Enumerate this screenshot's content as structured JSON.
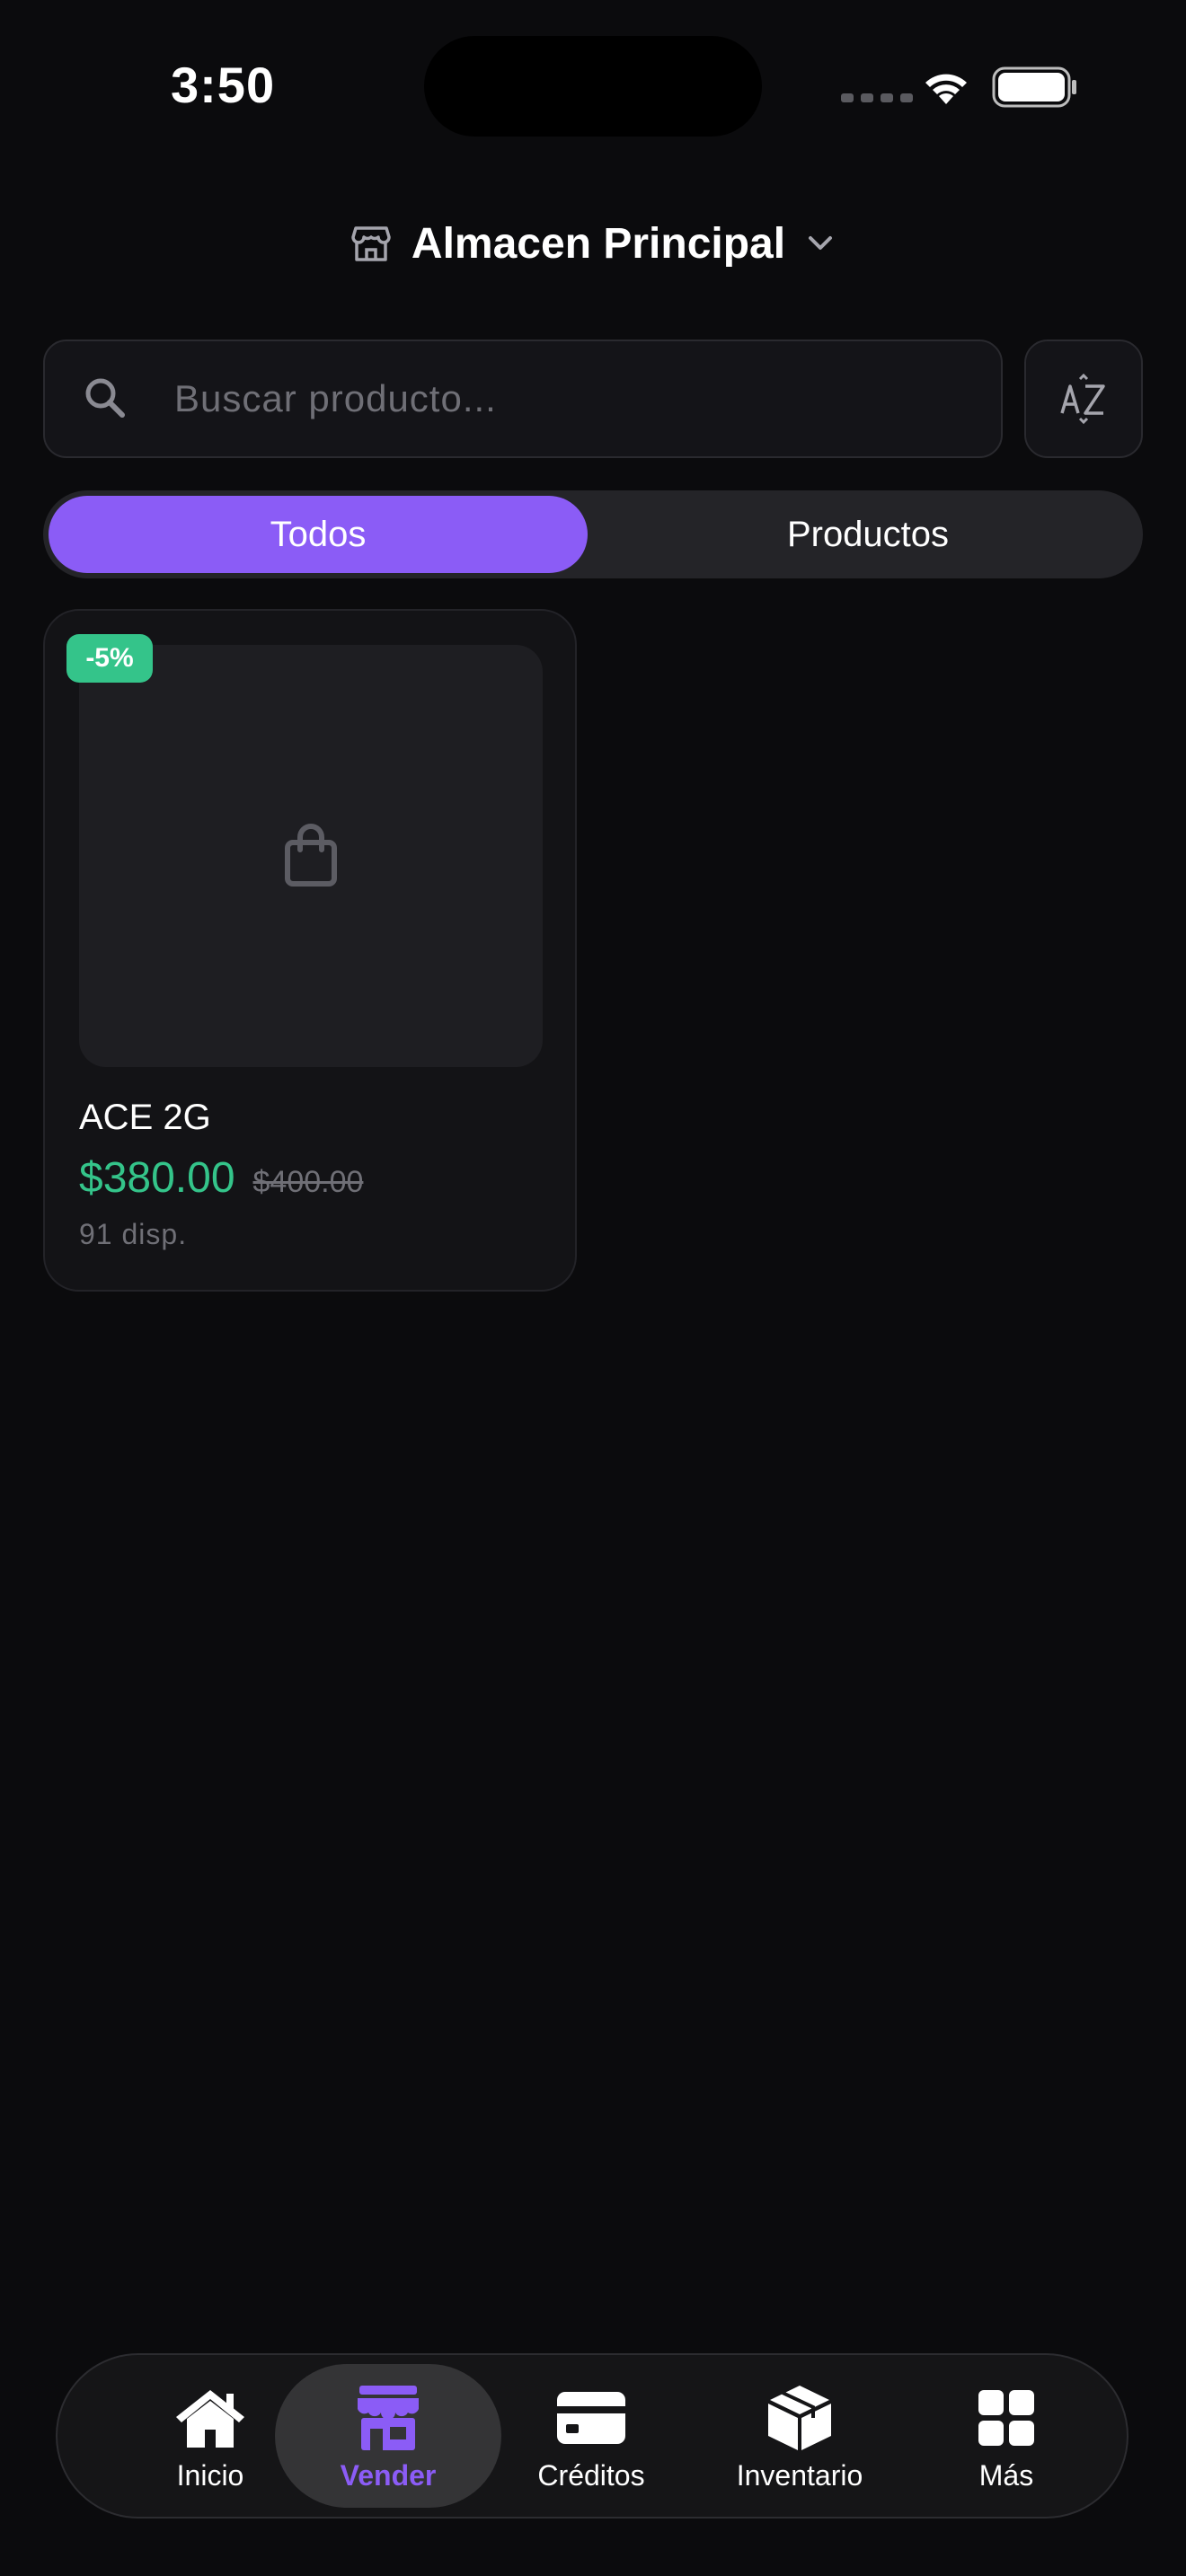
{
  "status_bar": {
    "time": "3:50",
    "wifi_icon": "wifi-icon",
    "battery_icon": "battery-icon"
  },
  "header": {
    "store_name": "Almacen Principal",
    "store_icon": "store-icon",
    "dropdown_icon": "chevron-down-icon"
  },
  "search": {
    "placeholder": "Buscar producto...",
    "value": "",
    "icon": "search-icon",
    "sort_icon": "sort-az-icon"
  },
  "filter_tabs": [
    {
      "label": "Todos",
      "active": true
    },
    {
      "label": "Productos",
      "active": false
    }
  ],
  "products": [
    {
      "name": "ACE 2G",
      "price": "$380.00",
      "original_price": "$400.00",
      "discount_badge": "-5%",
      "stock": "91 disp.",
      "image_icon": "shopping-bag-icon"
    }
  ],
  "bottom_nav": [
    {
      "label": "Inicio",
      "icon": "home-icon",
      "active": false
    },
    {
      "label": "Vender",
      "icon": "storefront-icon",
      "active": true
    },
    {
      "label": "Créditos",
      "icon": "credit-card-icon",
      "active": false
    },
    {
      "label": "Inventario",
      "icon": "box-icon",
      "active": false
    },
    {
      "label": "Más",
      "icon": "grid-icon",
      "active": false
    }
  ],
  "colors": {
    "background": "#0b0b0d",
    "accent": "#8b5cf6",
    "price_green": "#34c48a",
    "muted_text": "#6f6f76"
  }
}
